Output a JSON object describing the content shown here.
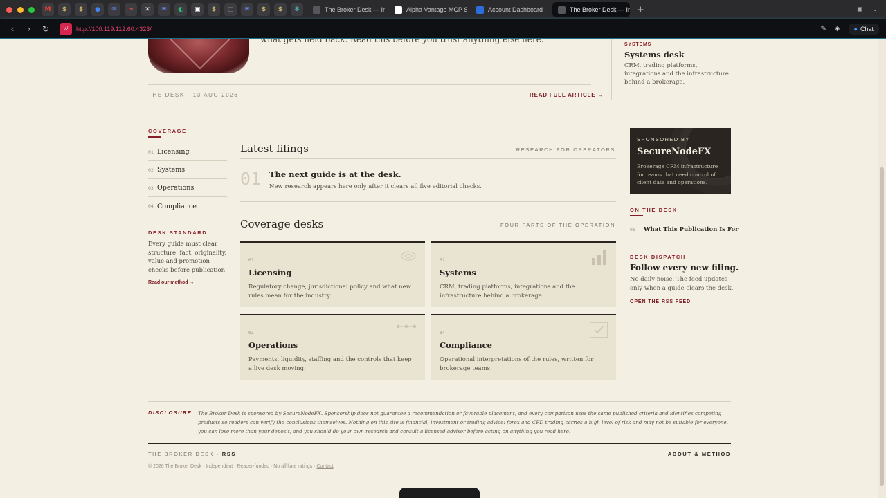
{
  "browser": {
    "tabs": [
      {
        "label": "The Broker Desk — Ind",
        "active": false
      },
      {
        "label": "Alpha Vantage MCP Se",
        "active": false
      },
      {
        "label": "Account Dashboard | n",
        "active": false
      },
      {
        "label": "The Broker Desk — Ind",
        "active": true
      }
    ],
    "url": "http://100.119.112.60:4323/",
    "chat_label": "Chat"
  },
  "hero": {
    "snippet": "what gets held back. Read this before you trust anything else here.",
    "meta": "THE DESK · 13 AUG 2026",
    "read_more": "READ FULL ARTICLE →"
  },
  "side_feature": {
    "kicker": "SYSTEMS",
    "title": "Systems desk",
    "desc": "CRM, trading platforms, integrations and the infrastructure behind a brokerage."
  },
  "coverage": {
    "heading": "COVERAGE",
    "items": [
      {
        "num": "01",
        "label": "Licensing"
      },
      {
        "num": "02",
        "label": "Systems"
      },
      {
        "num": "03",
        "label": "Operations"
      },
      {
        "num": "04",
        "label": "Compliance"
      }
    ]
  },
  "desk_standard": {
    "heading": "DESK STANDARD",
    "text": "Every guide must clear structure, fact, originality, value and promotion checks before publication.",
    "link": "Read our method →"
  },
  "filings": {
    "heading": "Latest filings",
    "meta": "RESEARCH FOR OPERATORS",
    "num": "01",
    "title": "The next guide is at the desk.",
    "desc": "New research appears here only after it clears all five editorial checks."
  },
  "desks": {
    "heading": "Coverage desks",
    "meta": "FOUR PARTS OF THE OPERATION",
    "cards": [
      {
        "num": "01",
        "title": "Licensing",
        "desc": "Regulatory change, jurisdictional policy and what new rules mean for the industry.",
        "icon": "ring-icon"
      },
      {
        "num": "02",
        "title": "Systems",
        "desc": "CRM, trading platforms, integrations and the infrastructure behind a brokerage.",
        "icon": "bars-icon"
      },
      {
        "num": "03",
        "title": "Operations",
        "desc": "Payments, liquidity, staffing and the controls that keep a live desk moving.",
        "icon": "nodes-icon"
      },
      {
        "num": "04",
        "title": "Compliance",
        "desc": "Operational interpretations of the rules, written for brokerage teams.",
        "icon": "check-icon"
      }
    ]
  },
  "sponsor": {
    "kicker": "SPONSORED BY",
    "name": "SecureNodeFX",
    "desc": "Brokerage CRM infrastructure for teams that need control of client data and operations."
  },
  "on_the_desk": {
    "heading": "ON THE DESK",
    "num": "01",
    "title": "What This Publication Is For"
  },
  "dispatch": {
    "heading": "DESK DISPATCH",
    "title": "Follow every new filing.",
    "text": "No daily noise. The feed updates only when a guide clears the desk.",
    "link": "OPEN THE RSS FEED →"
  },
  "footer": {
    "disclosure_label": "DISCLOSURE",
    "disclosure_text": "The Broker Desk is sponsored by SecureNodeFX. Sponsorship does not guarantee a recommendation or favorable placement, and every comparison uses the same published criteria and identifies competing products so readers can verify the conclusions themselves. Nothing on this site is financial, investment or trading advice: forex and CFD trading carries a high level of risk and may not be suitable for everyone, you can lose more than your deposit, and you should do your own research and consult a licensed advisor before acting on anything you read here.",
    "brand": "THE BROKER DESK",
    "rss": "RSS",
    "about": "ABOUT & METHOD",
    "copyright": "© 2026 The Broker Desk · Independent · Reader-funded · No affiliate ratings ·",
    "contact": "Contact"
  }
}
